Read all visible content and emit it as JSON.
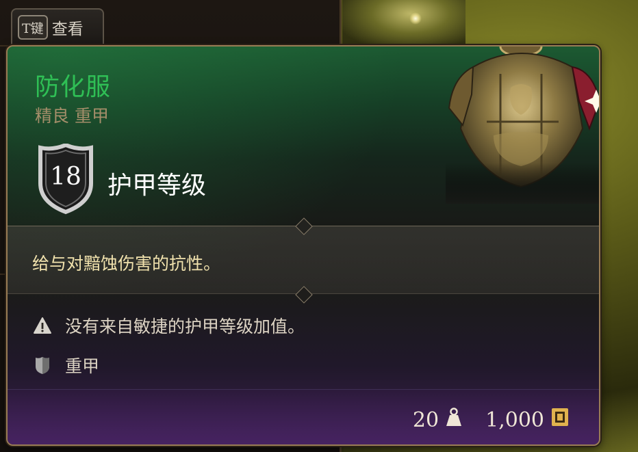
{
  "key_hint": {
    "key": "T键",
    "action": "查看"
  },
  "item": {
    "name": "防化服",
    "rarity_type": "精良 重甲",
    "name_color": "#2fbf55",
    "armor_class_value": "18",
    "armor_class_label": "护甲等级",
    "description": "给与对黯蚀伤害的抗性。",
    "properties": [
      {
        "icon": "warning-icon",
        "text": "没有来自敏捷的护甲等级加值。"
      },
      {
        "icon": "heavy-armour-icon",
        "text": "重甲"
      }
    ],
    "weight": "20",
    "weight_icon": "weight-icon",
    "value": "1,000",
    "value_icon": "gold-coin-icon"
  }
}
